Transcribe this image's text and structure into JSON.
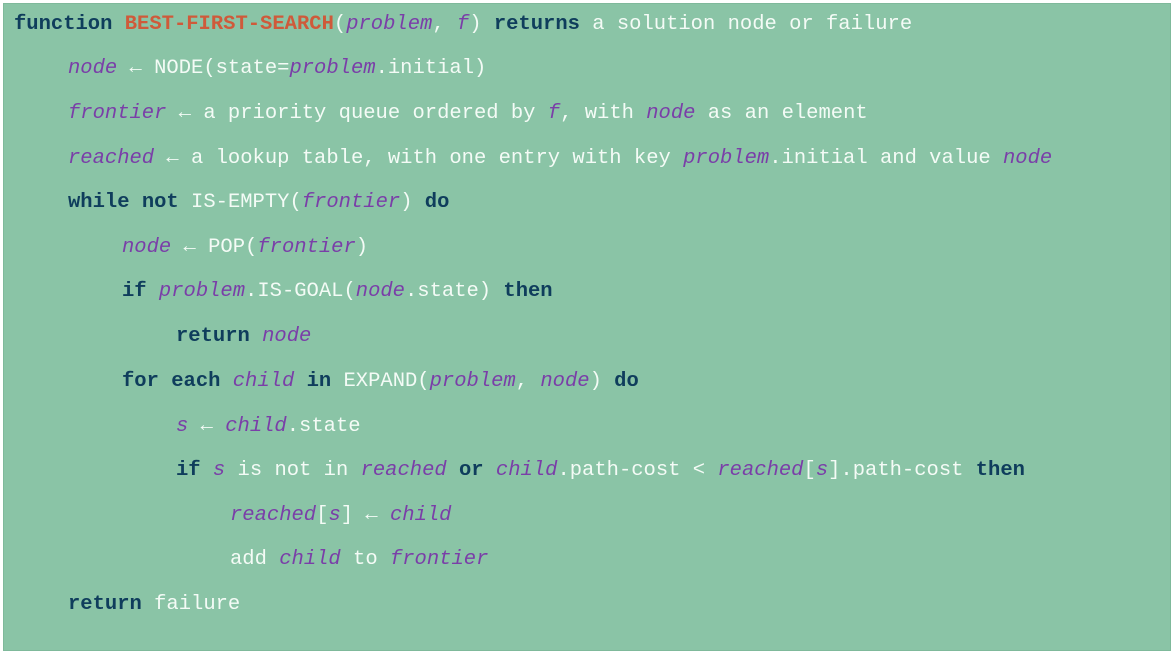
{
  "colors": {
    "background": "#8ac4a6",
    "keyword": "#0f3d5c",
    "function_name": "#cf5a3a",
    "variable": "#7a3ea8",
    "plain_text": "#f4fbf6"
  },
  "code": {
    "l1": [
      "function",
      "BEST-FIRST-SEARCH",
      "(",
      "problem",
      ", ",
      "f",
      ") ",
      "returns",
      " a solution node or failure"
    ],
    "l2": [
      "node",
      " ← NODE(state=",
      "problem",
      ".initial)"
    ],
    "l3": [
      "frontier",
      " ← a priority queue ordered by ",
      "f",
      ", with ",
      "node",
      " as an element"
    ],
    "l4": [
      "reached",
      " ← a lookup table, with one entry with key ",
      "problem",
      ".initial and value ",
      "node"
    ],
    "l5": [
      "while",
      " ",
      "not",
      " IS-EMPTY(",
      "frontier",
      ") ",
      "do"
    ],
    "l6": [
      "node",
      " ← POP(",
      "frontier",
      ")"
    ],
    "l7": [
      "if",
      " ",
      "problem",
      ".IS-GOAL(",
      "node",
      ".state) ",
      "then"
    ],
    "l8": [
      "return",
      " ",
      "node"
    ],
    "l9": [
      "for",
      " ",
      "each",
      " ",
      "child",
      " ",
      "in",
      " EXPAND(",
      "problem",
      ", ",
      "node",
      ") ",
      "do"
    ],
    "l10": [
      "s",
      " ← ",
      "child",
      ".state"
    ],
    "l11": [
      "if",
      " ",
      "s",
      " is not in ",
      "reached",
      " ",
      "or",
      " ",
      "child",
      ".path-cost < ",
      "reached",
      "[",
      "s",
      "].path-cost ",
      "then"
    ],
    "l12": [
      "reached",
      "[",
      "s",
      "] ← ",
      "child"
    ],
    "l13": [
      "add ",
      "child",
      " to ",
      "frontier"
    ],
    "l14": [
      "return",
      " failure"
    ]
  }
}
